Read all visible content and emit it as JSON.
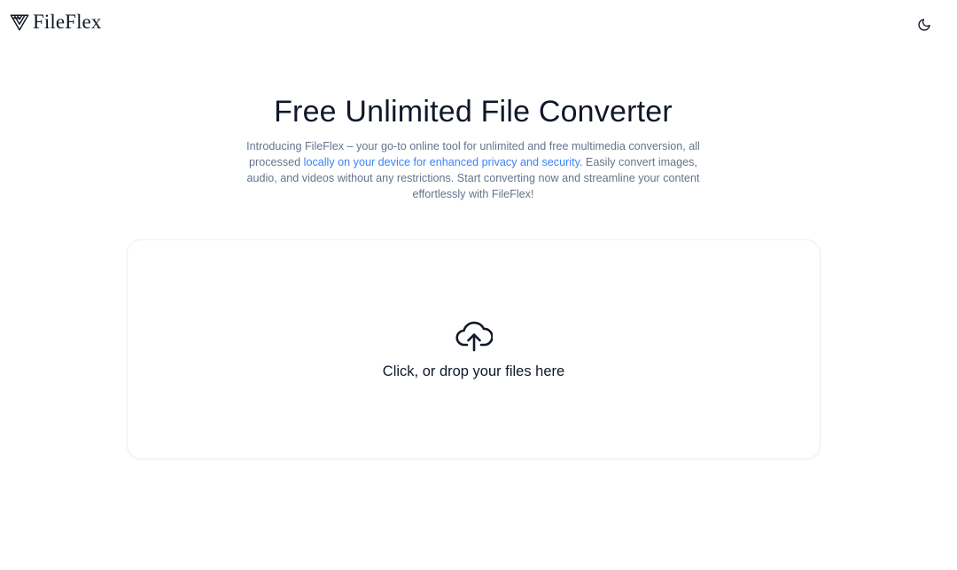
{
  "header": {
    "brand_name": "FileFlex",
    "logo_icon": "fileflex-logo-icon",
    "theme_toggle_icon": "moon-icon"
  },
  "hero": {
    "title": "Free Unlimited File Converter",
    "description_part1": "Introducing FileFlex – your go-to online tool for unlimited and free multimedia conversion, all processed ",
    "description_highlight": "locally on your device for enhanced privacy and security",
    "description_part2": ". Easily convert images, audio, and videos without any restrictions. Start converting now and streamline your content effortlessly with FileFlex!"
  },
  "dropzone": {
    "icon": "cloud-upload-icon",
    "label": "Click, or drop your files here"
  },
  "colors": {
    "text_primary": "#0f172a",
    "text_muted": "#64748b",
    "accent_link": "#3b82f6",
    "border": "#eef0f3",
    "background": "#ffffff"
  }
}
